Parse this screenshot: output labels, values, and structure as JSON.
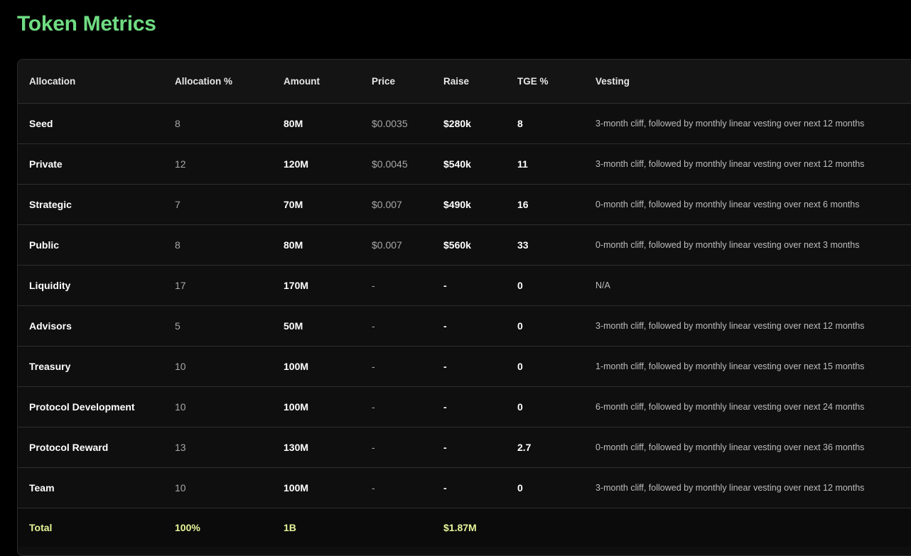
{
  "page": {
    "title": "Token Metrics"
  },
  "table": {
    "headers": [
      "Allocation",
      "Allocation %",
      "Amount",
      "Price",
      "Raise",
      "TGE %",
      "Vesting"
    ],
    "rows": [
      {
        "allocation": "Seed",
        "percent": "8",
        "amount": "80M",
        "price": "$0.0035",
        "raise": "$280k",
        "tge": "8",
        "vesting": "3-month cliff, followed by monthly linear vesting over next 12 months"
      },
      {
        "allocation": "Private",
        "percent": "12",
        "amount": "120M",
        "price": "$0.0045",
        "raise": "$540k",
        "tge": "11",
        "vesting": "3-month cliff, followed by monthly linear vesting over next 12 months"
      },
      {
        "allocation": "Strategic",
        "percent": "7",
        "amount": "70M",
        "price": "$0.007",
        "raise": "$490k",
        "tge": "16",
        "vesting": "0-month cliff, followed by monthly linear vesting over next 6 months"
      },
      {
        "allocation": "Public",
        "percent": "8",
        "amount": "80M",
        "price": "$0.007",
        "raise": "$560k",
        "tge": "33",
        "vesting": "0-month cliff, followed by monthly linear vesting over next 3 months"
      },
      {
        "allocation": "Liquidity",
        "percent": "17",
        "amount": "170M",
        "price": "-",
        "raise": "-",
        "tge": "0",
        "vesting": "N/A"
      },
      {
        "allocation": "Advisors",
        "percent": "5",
        "amount": "50M",
        "price": "-",
        "raise": "-",
        "tge": "0",
        "vesting": "3-month cliff, followed by monthly linear vesting over next 12 months"
      },
      {
        "allocation": "Treasury",
        "percent": "10",
        "amount": "100M",
        "price": "-",
        "raise": "-",
        "tge": "0",
        "vesting": "1-month cliff, followed by monthly linear vesting over next 15 months"
      },
      {
        "allocation": "Protocol Development",
        "percent": "10",
        "amount": "100M",
        "price": "-",
        "raise": "-",
        "tge": "0",
        "vesting": "6-month cliff, followed by monthly linear vesting over next 24 months"
      },
      {
        "allocation": "Protocol Reward",
        "percent": "13",
        "amount": "130M",
        "price": "-",
        "raise": "-",
        "tge": "2.7",
        "vesting": "0-month cliff, followed by monthly linear vesting over next 36 months"
      },
      {
        "allocation": "Team",
        "percent": "10",
        "amount": "100M",
        "price": "-",
        "raise": "-",
        "tge": "0",
        "vesting": "3-month cliff, followed by monthly linear vesting over next 12 months"
      }
    ],
    "total": {
      "label": "Total",
      "percent": "100%",
      "amount": "1B",
      "raise": "$1.87M"
    }
  },
  "colors": {
    "title": "#6fdc82",
    "total_text": "#e8f59a",
    "background": "#000000",
    "card": "#0f0f0f"
  }
}
